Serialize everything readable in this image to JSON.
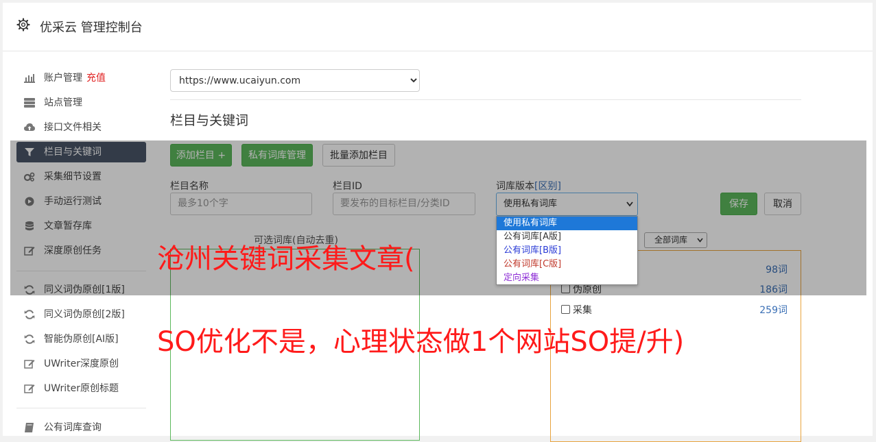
{
  "header": {
    "title": "优采云 管理控制台",
    "icon": "gear-icon"
  },
  "sidebar": {
    "items": [
      {
        "label": "账户管理",
        "badge": "充值",
        "icon": "bar-chart-icon"
      },
      {
        "label": "站点管理",
        "icon": "server-icon"
      },
      {
        "label": "接口文件相关",
        "icon": "cloud-upload-icon"
      },
      {
        "label": "栏目与关键词",
        "icon": "filter-icon",
        "active": true
      },
      {
        "label": "采集细节设置",
        "icon": "cogs-icon"
      },
      {
        "label": "手动运行测试",
        "icon": "play-circle-icon"
      },
      {
        "label": "文章暂存库",
        "icon": "database-icon"
      },
      {
        "label": "深度原创任务",
        "icon": "edit-icon"
      },
      {
        "label": "同义词伪原创[1版]",
        "icon": "refresh-icon"
      },
      {
        "label": "同义词伪原创[2版]",
        "icon": "refresh-icon"
      },
      {
        "label": "智能伪原创[AI版]",
        "icon": "refresh-icon"
      },
      {
        "label": "UWriter深度原创",
        "icon": "edit-icon"
      },
      {
        "label": "UWriter原创标题",
        "icon": "edit-icon"
      },
      {
        "label": "公有词库查询",
        "icon": "book-icon"
      }
    ]
  },
  "main": {
    "site_select": {
      "value": "https://www.ucaiyun.com"
    },
    "section_title": "栏目与关键词",
    "buttons": {
      "add_column": "添加栏目 +",
      "private_lib": "私有词库管理",
      "batch_add": "批量添加栏目",
      "save": "保存",
      "cancel": "取消"
    },
    "fields": {
      "column_name_label": "栏目名称",
      "column_name_placeholder": "最多10个字",
      "column_id_label": "栏目ID",
      "column_id_placeholder": "要发布的目标栏目/分类ID",
      "lib_version_label": "词库版本",
      "lib_version_link": "[区别]",
      "lib_version_value": "使用私有词库"
    },
    "dropdown_options": [
      {
        "label": "使用私有词库",
        "color": "#ffffff",
        "selected": true
      },
      {
        "label": "公有词库[A版]",
        "color": "#333333"
      },
      {
        "label": "公有词库[B版]",
        "color": "#2a3bd6"
      },
      {
        "label": "公有词库[C版]",
        "color": "#c0392b"
      },
      {
        "label": "定向采集",
        "color": "#8e2fd6"
      }
    ],
    "box_label": "可选词库(自动去重)",
    "lib_filter": "全部词库",
    "libraries": [
      {
        "name": "",
        "count": "98词"
      },
      {
        "name": "伪原创",
        "count": "186词"
      },
      {
        "name": "采集",
        "count": "259词"
      }
    ]
  },
  "watermark": {
    "line1": "沧州关键词采集文章(",
    "line2": "SO优化不是，心理状态做1个网站SO提/升)"
  }
}
